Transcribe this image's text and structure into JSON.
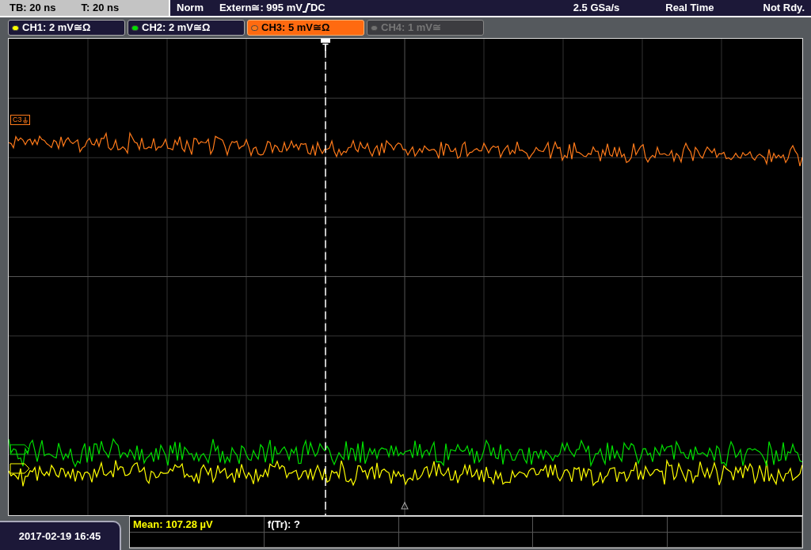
{
  "status_bar": {
    "timebase": "TB: 20 ns",
    "trigger_time": "T: 20 ns",
    "mode": "Norm",
    "trigger_source": "Extern≅: 995 mV",
    "trigger_coupling": "DC",
    "sample_rate": "2.5 GSa/s",
    "acquisition": "Real Time",
    "state": "Not Rdy."
  },
  "channels": [
    {
      "label": "CH1: 2 mV≅Ω",
      "color": "#ffff00",
      "selected": false,
      "disabled": false
    },
    {
      "label": "CH2: 2 mV≅Ω",
      "color": "#00e000",
      "selected": false,
      "disabled": false
    },
    {
      "label": "CH3: 5 mV≅Ω",
      "color": "#ff7a1a",
      "selected": true,
      "disabled": false
    },
    {
      "label": "CH4: 1 mV≅",
      "color": "#707070",
      "selected": false,
      "disabled": true
    }
  ],
  "plot": {
    "marker_label": "C3",
    "trigger_label": "T"
  },
  "date": "2017-02-19 16:45",
  "measurements": [
    {
      "text": "Mean: 107.28 µV",
      "color": "#ffff00"
    },
    {
      "text": "f(Tr): ?",
      "color": "#ffffff"
    }
  ]
}
